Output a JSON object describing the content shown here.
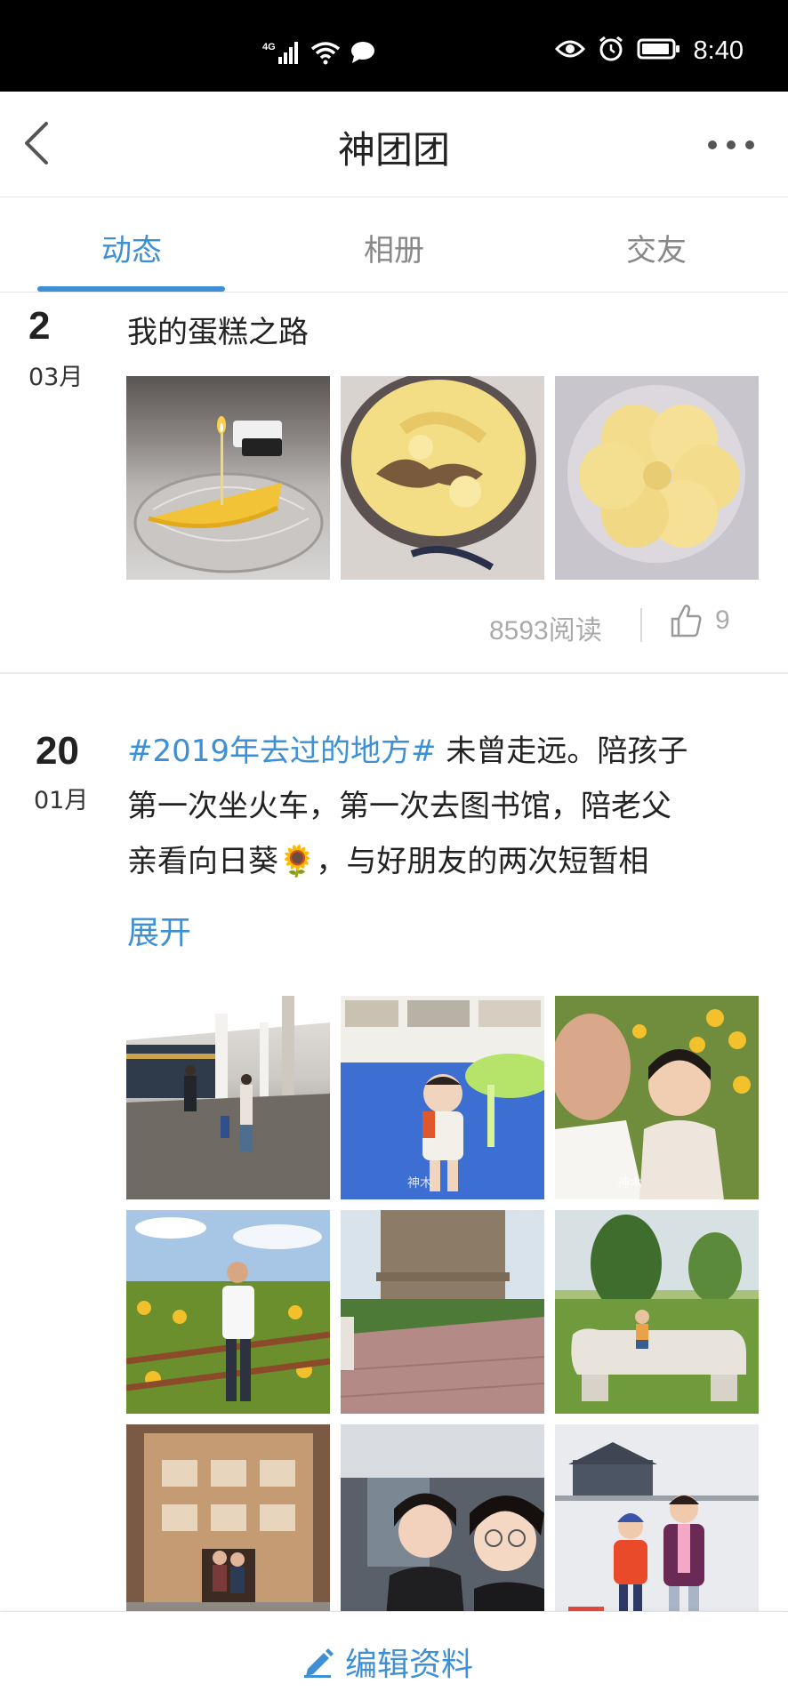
{
  "status_bar": {
    "network": "4G",
    "time": "8:40"
  },
  "header": {
    "title": "神团团"
  },
  "tabs": [
    {
      "label": "动态",
      "active": true
    },
    {
      "label": "相册",
      "active": false
    },
    {
      "label": "交友",
      "active": false
    }
  ],
  "posts": [
    {
      "day": "2",
      "month": "03月",
      "title": "我的蛋糕之路",
      "photos": [
        "cake-with-candle",
        "baked-cake-in-pan",
        "flower-shaped-bread"
      ],
      "reads": "8593阅读",
      "likes": "9"
    },
    {
      "day": "20",
      "month": "01月",
      "hashtag": "#2019年去过的地方#",
      "line1_rest": " 未曾走远。陪孩子",
      "line2": "第一次坐火车，第一次去图书馆，陪老父",
      "line3": "亲看向日葵🌻，与好朋友的两次短暂相",
      "expand_label": "展开",
      "photos": [
        "train-platform",
        "child-in-library",
        "selfie-sunflowers",
        "man-in-sunflower-field",
        "great-wall-tower",
        "child-on-bench",
        "old-building",
        "friends-selfie",
        "kids-in-snow"
      ]
    }
  ],
  "bottom_bar": {
    "edit_label": "编辑资料"
  },
  "colors": {
    "accent": "#3d8fd6",
    "text": "#222222",
    "muted": "#aaaaaa"
  }
}
